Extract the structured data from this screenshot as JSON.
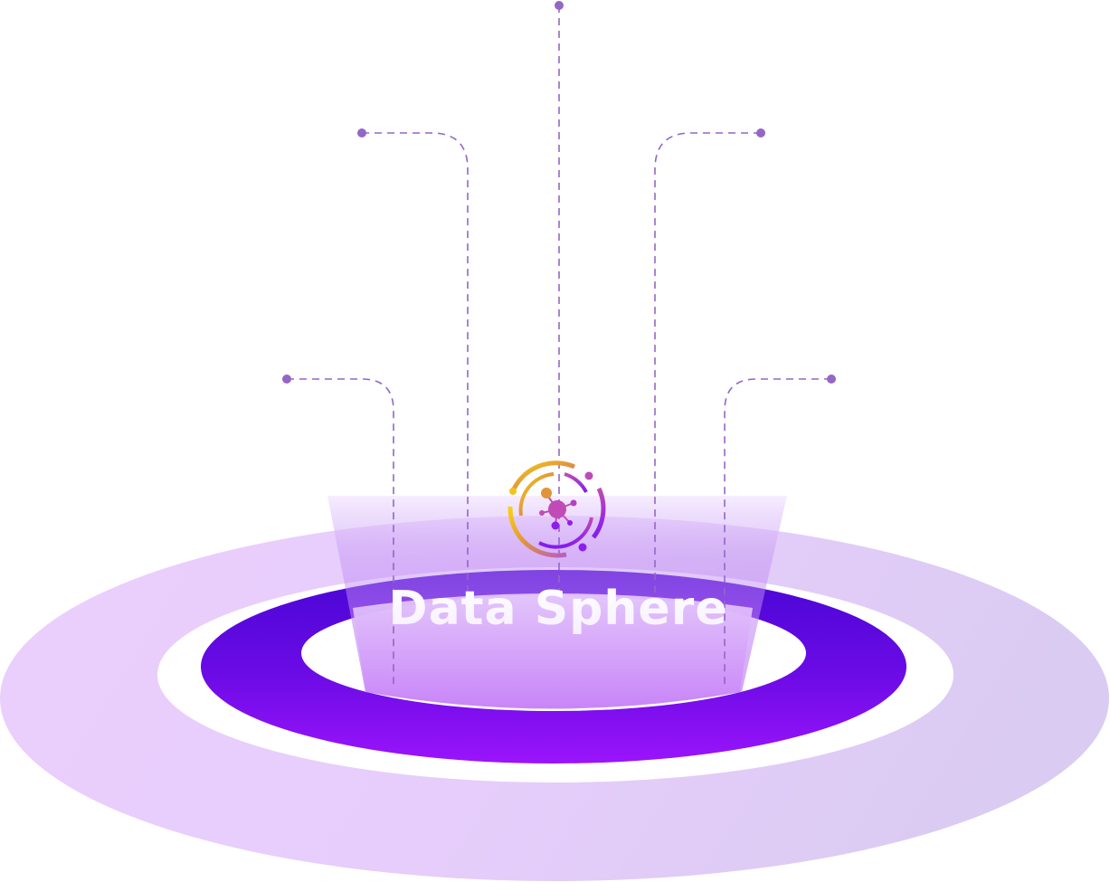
{
  "title": "Data Sphere",
  "colors": {
    "connector": "#9466c6",
    "outer_platform": "#e8cdfc",
    "outer_platform_edge": "#dcc9f2",
    "inner_ring_top": "#4a06d6",
    "inner_ring_bottom": "#9b14fb",
    "beam": "#c07cf7",
    "icon_gold": "#f4c21c",
    "icon_orange": "#e0953a",
    "icon_magenta": "#c04bb6",
    "icon_purple": "#8c1df0"
  },
  "icons": {
    "center": "network-node-icon"
  }
}
